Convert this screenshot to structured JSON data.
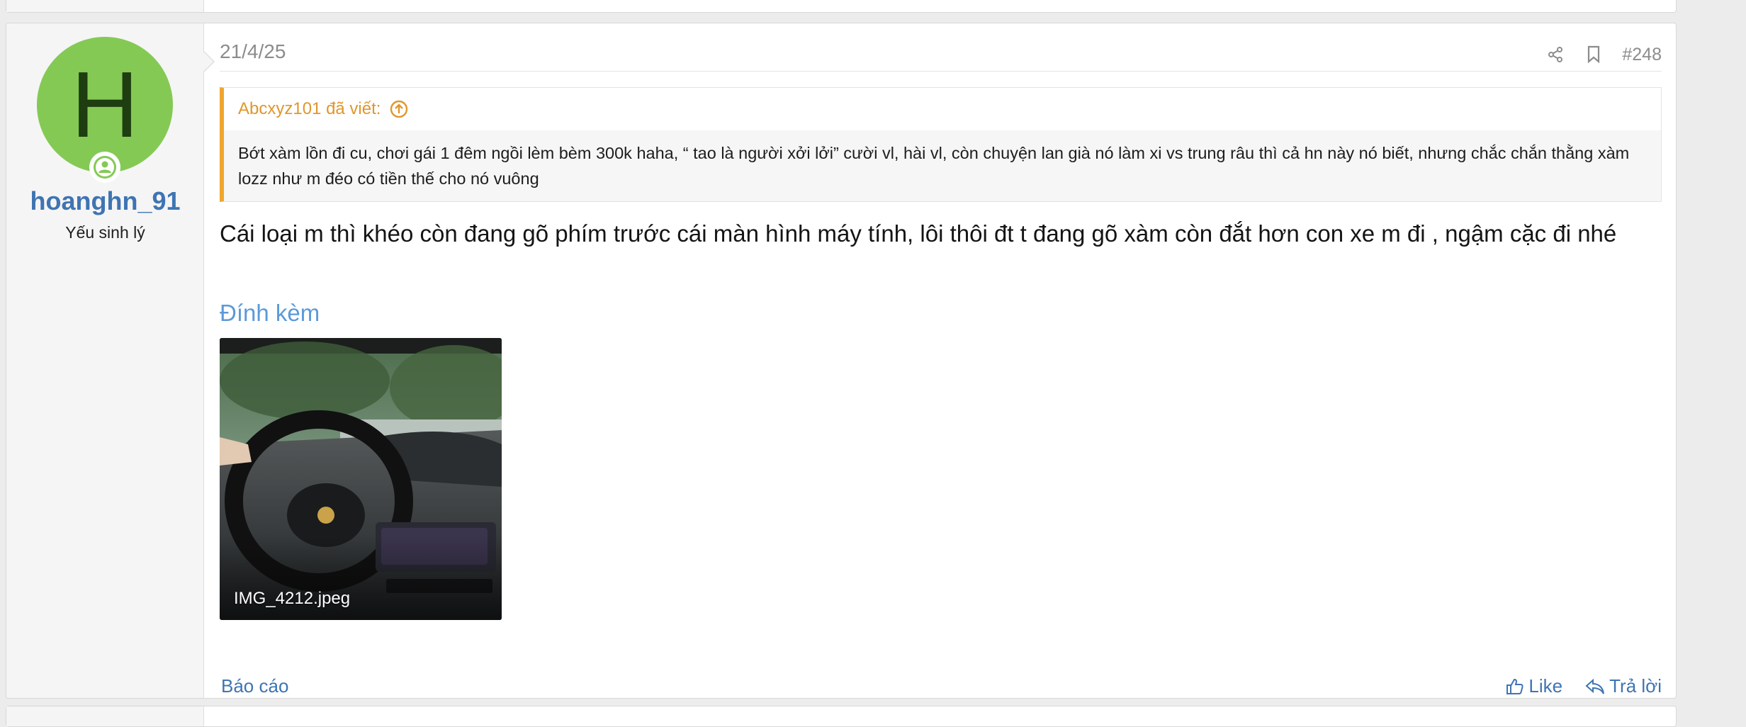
{
  "post": {
    "date": "21/4/25",
    "number": "#248",
    "author": {
      "initial": "H",
      "username": "hoanghn_91",
      "title": "Yếu sinh lý",
      "avatar_color": "#85c955"
    },
    "quote": {
      "header": "Abcxyz101 đã viết:",
      "text": "Bớt xàm lồn đi cu, chơi gái 1 đêm ngồi lèm bèm 300k haha, “ tao là người xởi lởi” cười vl, hài vl, còn chuyện lan già nó làm xi vs trung râu thì cả hn này nó biết, nhưng chắc chắn thằng xàm lozz như m đéo có tiền thế cho nó vuông"
    },
    "body": "Cái loại m thì khéo còn đang gõ phím trước cái màn hình máy tính, lôi thôi đt t đang gõ xàm còn đắt hơn con xe m đi , ngậm cặc đi nhé",
    "attachments_title": "Đính kèm",
    "attachment": {
      "filename": "IMG_4212.jpeg",
      "icon": "car-interior-photo"
    },
    "footer": {
      "report": "Báo cáo",
      "like": "Like",
      "reply": "Trả lời"
    }
  },
  "colors": {
    "link": "#3f74b3",
    "quote_accent": "#f0a52e",
    "attach_title": "#5b9ad8"
  }
}
